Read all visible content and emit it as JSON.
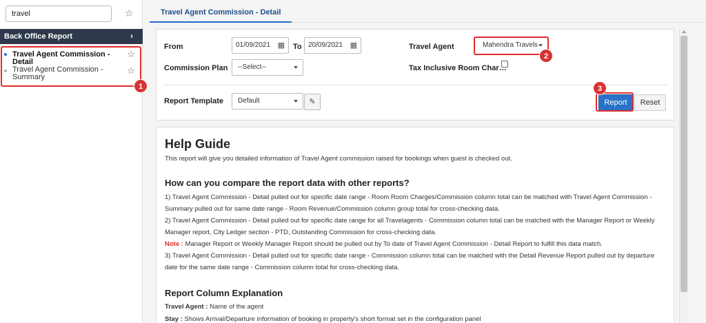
{
  "sidebar": {
    "search_value": "travel",
    "section_title": "Back Office Report",
    "items": [
      {
        "label": "Travel Agent Commission - Detail"
      },
      {
        "label": "Travel Agent Commission - Summary"
      }
    ]
  },
  "tab": {
    "label": "Travel Agent Commission - Detail"
  },
  "filters": {
    "from_label": "From",
    "from_value": "01/09/2021",
    "to_label": "To",
    "to_value": "20/09/2021",
    "travel_agent_label": "Travel Agent",
    "travel_agent_value": "Mahendra Travels",
    "commission_plan_label": "Commission Plan",
    "commission_plan_value": "--Select--",
    "tax_label": "Tax Inclusive Room Char…",
    "report_template_label": "Report Template",
    "report_template_value": "Default",
    "report_button": "Report",
    "reset_button": "Reset"
  },
  "badges": [
    "1",
    "2",
    "3"
  ],
  "help": {
    "title": "Help Guide",
    "intro": "This report will give you detailed information of Travel Agent commission raised for bookings when guest is checked out.",
    "compare_heading": "How can you compare the report data with other reports?",
    "point1": "1) Travel Agent Commission - Detail pulled out for specific date range - Room Room Charges/Commission column total can be matched with Travel Agent Commission - Summary pulled out for same date range - Room Revenue/Commission column group total for cross-checking data.",
    "point2": "2) Travel Agent Commission - Detail pulled out for specific date range for all Travelagents - Commission column total can be matched with the Manager Report or Weekly Manager report, City Ledger section - PTD, Outstanding Commission for cross-checking data.",
    "note_label": "Note :",
    "note_text": " Manager Report or Weekly Manager Report should be pulled out by To date of Travel Agent Commission - Detail Report to fulfill this data match.",
    "point3": "3) Travel Agent Commission - Detail pulled out for specific date range - Commission column total can be matched with the Detail Revenue Report pulled out by departure date for the same date range - Commission column total for cross-checking data.",
    "columns_heading": "Report Column Explanation",
    "col1_label": "Travel Agent :",
    "col1_text": " Name of the agent",
    "col2_label": "Stay :",
    "col2_text": " Shows Arrival/Departure information of booking in property's short format set in the configuration panel"
  },
  "colors": {
    "accent": "#2a72c9",
    "highlight": "#e02b2b",
    "sidebar_header": "#2e3a4b"
  }
}
